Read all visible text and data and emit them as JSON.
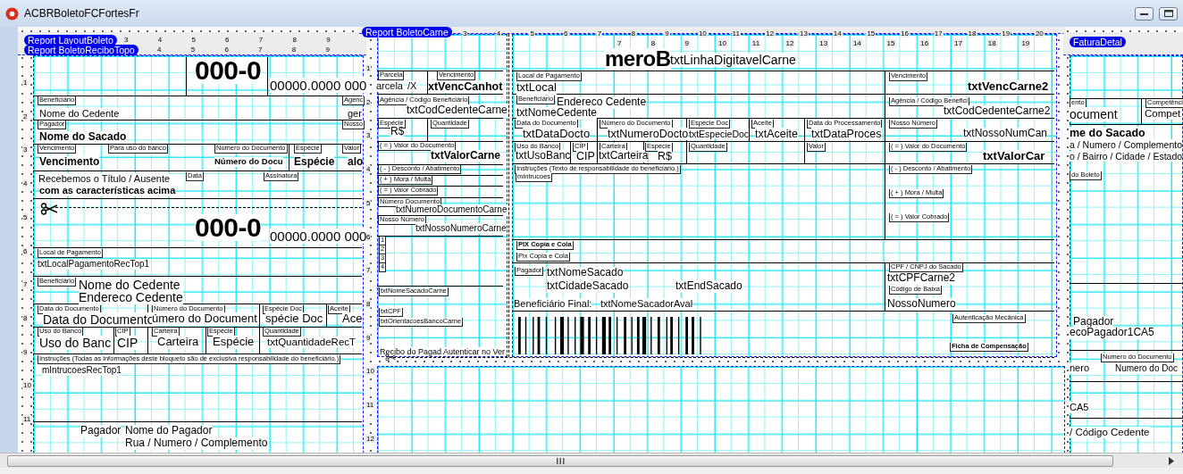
{
  "window": {
    "title": "ACBRBoletoFCFortesFr"
  },
  "bands": [
    "Report LayoutBoleto",
    "Report BoletoReciboTopo",
    "Report BoletoCarne",
    "FaturaDetal"
  ],
  "rulers": [
    {
      "labels": [
        "3",
        "4",
        "5",
        "6",
        "7",
        "8",
        "9"
      ]
    },
    {
      "labels": [
        "4",
        "5",
        "6",
        "7",
        "8",
        "9"
      ]
    },
    {
      "labels": [
        "1",
        "2",
        "3",
        "4",
        "5",
        "6",
        "7",
        "8",
        "9",
        "10",
        "11"
      ]
    },
    {
      "labels": [
        "3",
        "4",
        "5",
        "6",
        "7",
        "8",
        "9",
        "10",
        "11",
        "12",
        "13",
        "14",
        "15",
        "16",
        "17",
        "18",
        "19",
        "20"
      ]
    },
    {
      "labels": [
        "7",
        "8",
        "9",
        "10",
        "11",
        "12",
        "13",
        "14",
        "15",
        "16",
        "17",
        "18",
        "19"
      ]
    },
    {
      "labels": [
        "1",
        "2",
        "3",
        "4",
        "5",
        "6",
        "7",
        "8",
        "9",
        "10",
        "11",
        "12"
      ]
    }
  ],
  "fields": [
    {
      "kind": "big",
      "text": "000-0"
    },
    {
      "kind": "value",
      "text": "00000.0000 000"
    },
    {
      "kind": "caption",
      "text": "Beneficiário"
    },
    {
      "kind": "value",
      "text": "Nome do Cedente"
    },
    {
      "kind": "caption",
      "text": "Agenc"
    },
    {
      "kind": "value",
      "text": "ger"
    },
    {
      "kind": "caption",
      "text": "Pagador"
    },
    {
      "kind": "bold",
      "text": "Nome do Sacado"
    },
    {
      "kind": "caption",
      "text": "Nosso"
    },
    {
      "kind": "caption",
      "text": "Vencimento"
    },
    {
      "kind": "caption",
      "text": "Para uso do banco"
    },
    {
      "kind": "caption",
      "text": "Número do Documento"
    },
    {
      "kind": "caption",
      "text": "Espécie"
    },
    {
      "kind": "caption",
      "text": "Valor"
    },
    {
      "kind": "bold",
      "text": "Vencimento"
    },
    {
      "kind": "bold",
      "text": "Número do Docu"
    },
    {
      "kind": "bold",
      "text": "Espécie"
    },
    {
      "kind": "bold",
      "text": "alo"
    },
    {
      "kind": "value",
      "text": "Recebemos o Título / Ausente"
    },
    {
      "kind": "caption",
      "text": "Data"
    },
    {
      "kind": "caption",
      "text": "Assinatura"
    },
    {
      "kind": "bold",
      "text": "com as características acima"
    },
    {
      "kind": "big",
      "text": "000-0"
    },
    {
      "kind": "value",
      "text": "00000.0000 000"
    },
    {
      "kind": "caption",
      "text": "Local de Pagamento"
    },
    {
      "kind": "value",
      "text": "txtLocalPagamentoRecTop1"
    },
    {
      "kind": "caption",
      "text": "Beneficiário"
    },
    {
      "kind": "value",
      "text": "Nome do Cedente"
    },
    {
      "kind": "value",
      "text": "Endereco Cedente"
    },
    {
      "kind": "caption",
      "text": "Data do Documento"
    },
    {
      "kind": "value",
      "text": "Data do Documento"
    },
    {
      "kind": "caption",
      "text": "Número do Documento"
    },
    {
      "kind": "value",
      "text": "úmero do Document"
    },
    {
      "kind": "caption",
      "text": "Espécie Doc"
    },
    {
      "kind": "value",
      "text": "spécie Doc"
    },
    {
      "kind": "caption",
      "text": "Aceite"
    },
    {
      "kind": "value",
      "text": "Ace"
    },
    {
      "kind": "caption",
      "text": "Uso do Banco"
    },
    {
      "kind": "value",
      "text": "Uso do Banc"
    },
    {
      "kind": "caption",
      "text": "CIP"
    },
    {
      "kind": "value",
      "text": "CIP"
    },
    {
      "kind": "caption",
      "text": "Carteira"
    },
    {
      "kind": "value",
      "text": "Carteira"
    },
    {
      "kind": "caption",
      "text": "Espécie"
    },
    {
      "kind": "value",
      "text": "Espécie"
    },
    {
      "kind": "caption",
      "text": "Quantidade"
    },
    {
      "kind": "value",
      "text": "txtQuantidadeRecT"
    },
    {
      "kind": "caption",
      "text": "Instruções (Todas as informações deste bloqueto são de exclusiva responsabilidade do beneficiário.)"
    },
    {
      "kind": "value",
      "text": "mIntrucoesRecTop1"
    },
    {
      "kind": "value",
      "text": "Pagador"
    },
    {
      "kind": "value",
      "text": "Nome do Pagador"
    },
    {
      "kind": "value",
      "text": "Rua / Numero / Complemento"
    },
    {
      "kind": "caption",
      "text": "Parcela"
    },
    {
      "kind": "value",
      "text": "arcela"
    },
    {
      "kind": "value",
      "text": "/X"
    },
    {
      "kind": "caption",
      "text": "Vencimento"
    },
    {
      "kind": "bold",
      "text": "xtVencCanhot"
    },
    {
      "kind": "caption",
      "text": "Agência / Código Beneficiário"
    },
    {
      "kind": "value",
      "text": "txtCodCedenteCarne"
    },
    {
      "kind": "caption",
      "text": "Espécie"
    },
    {
      "kind": "value",
      "text": "R$"
    },
    {
      "kind": "caption",
      "text": "Quantidade"
    },
    {
      "kind": "caption",
      "text": "( = ) Valor do Documento"
    },
    {
      "kind": "bold",
      "text": "txtValorCarne"
    },
    {
      "kind": "caption",
      "text": "( - ) Desconto / Abatimento"
    },
    {
      "kind": "caption",
      "text": "( + ) Mora / Multa"
    },
    {
      "kind": "caption",
      "text": "( = ) Valor Cobrado"
    },
    {
      "kind": "caption",
      "text": "Número Documento"
    },
    {
      "kind": "value",
      "text": "txtNumeroDocumentoCarne"
    },
    {
      "kind": "caption",
      "text": "Nosso Número"
    },
    {
      "kind": "value",
      "text": "txtNossoNumeroCarne"
    },
    {
      "kind": "caption",
      "text": "1"
    },
    {
      "kind": "caption",
      "text": "2"
    },
    {
      "kind": "caption",
      "text": "3"
    },
    {
      "kind": "caption",
      "text": "4"
    },
    {
      "kind": "caption",
      "text": "txtNomeSacadoCarne"
    },
    {
      "kind": "caption",
      "text": "txtCPF"
    },
    {
      "kind": "caption",
      "text": "txtOrientacoesBancoCarne"
    },
    {
      "kind": "value",
      "text": "Recibo do Pagad"
    },
    {
      "kind": "value",
      "text": "Autenticar no Ver"
    },
    {
      "kind": "big",
      "text": "meroB"
    },
    {
      "kind": "value",
      "text": "txtLinhaDigitavelCarne"
    },
    {
      "kind": "caption",
      "text": "Local de Pagamento"
    },
    {
      "kind": "value",
      "text": "txtLocal"
    },
    {
      "kind": "caption",
      "text": "Vencimento"
    },
    {
      "kind": "bold",
      "text": "txtVencCarne2"
    },
    {
      "kind": "caption",
      "text": "Beneficiário"
    },
    {
      "kind": "value",
      "text": "Endereco Cedente"
    },
    {
      "kind": "value",
      "text": "txtNomeCedente"
    },
    {
      "kind": "caption",
      "text": "Agência / Código Benefici"
    },
    {
      "kind": "value",
      "text": "txtCodCedenteCarne2"
    },
    {
      "kind": "caption",
      "text": "Data do Documento"
    },
    {
      "kind": "value",
      "text": "txtDataDocto"
    },
    {
      "kind": "caption",
      "text": "Número do Documento"
    },
    {
      "kind": "value",
      "text": "txtNumeroDocto"
    },
    {
      "kind": "caption",
      "text": "Espécie Doc"
    },
    {
      "kind": "value",
      "text": "txtEspecieDoc"
    },
    {
      "kind": "caption",
      "text": "Aceite"
    },
    {
      "kind": "value",
      "text": "txtAceite"
    },
    {
      "kind": "caption",
      "text": "Data do Processamento"
    },
    {
      "kind": "value",
      "text": "txtDataProces"
    },
    {
      "kind": "caption",
      "text": "Nosso Número"
    },
    {
      "kind": "value",
      "text": "txtNossoNumCan"
    },
    {
      "kind": "caption",
      "text": "Uso do Banco"
    },
    {
      "kind": "value",
      "text": "txtUsoBanc"
    },
    {
      "kind": "caption",
      "text": "CIP"
    },
    {
      "kind": "value",
      "text": "CIP"
    },
    {
      "kind": "caption",
      "text": "Carteira"
    },
    {
      "kind": "value",
      "text": "txtCarteira"
    },
    {
      "kind": "caption",
      "text": "Espécie"
    },
    {
      "kind": "value",
      "text": "R$"
    },
    {
      "kind": "caption",
      "text": "Quantidade"
    },
    {
      "kind": "caption",
      "text": "Valor"
    },
    {
      "kind": "caption",
      "text": "( = ) Valor do Documento"
    },
    {
      "kind": "bold",
      "text": "txtValorCar"
    },
    {
      "kind": "caption",
      "text": "Instruções (Texto de responsabilidade do beneficiário.)"
    },
    {
      "kind": "caption",
      "text": "mIntrucoes"
    },
    {
      "kind": "caption",
      "text": "( - ) Desconto / Abatimento"
    },
    {
      "kind": "caption",
      "text": "( + ) Mora / Multa"
    },
    {
      "kind": "caption",
      "text": "( = ) Valor Cobrado"
    },
    {
      "kind": "caption-bold",
      "text": "PIX Copia e Cola"
    },
    {
      "kind": "caption",
      "text": "Pix Copia e Cola"
    },
    {
      "kind": "caption",
      "text": "Pagador"
    },
    {
      "kind": "value",
      "text": "txtNomeSacado"
    },
    {
      "kind": "value",
      "text": "txtCidadeSacado"
    },
    {
      "kind": "value",
      "text": "txtEndSacado"
    },
    {
      "kind": "caption",
      "text": "CPF / CNPJ do Sacado"
    },
    {
      "kind": "value",
      "text": "txtCPFCarne2"
    },
    {
      "kind": "caption",
      "text": "Código de Baixa"
    },
    {
      "kind": "value",
      "text": "Beneficiário Final:"
    },
    {
      "kind": "value",
      "text": "txtNomeSacadorAval"
    },
    {
      "kind": "value",
      "text": "NossoNumero"
    },
    {
      "kind": "caption",
      "text": "Autenticação Mecânica"
    },
    {
      "kind": "caption-bold",
      "text": "Ficha de Compensação"
    },
    {
      "kind": "caption",
      "text": "ento"
    },
    {
      "kind": "value",
      "text": "ocument"
    },
    {
      "kind": "caption",
      "text": "Competênci"
    },
    {
      "kind": "value",
      "text": "Compet"
    },
    {
      "kind": "bold",
      "text": "me do Sacado"
    },
    {
      "kind": "value",
      "text": "a / Numero / Complemento"
    },
    {
      "kind": "value",
      "text": "o / Bairro / Cidade / Estado"
    },
    {
      "kind": "caption",
      "text": "do Boleto"
    },
    {
      "kind": "value",
      "text": "Pagador"
    },
    {
      "kind": "value",
      "text": "ecoPagador1CA5"
    },
    {
      "kind": "caption",
      "text": "Numero do Documento"
    },
    {
      "kind": "value",
      "text": "nero"
    },
    {
      "kind": "value",
      "text": "Numero do Doc"
    },
    {
      "kind": "value",
      "text": "CA5"
    },
    {
      "kind": "value",
      "text": "/ Código Cedente"
    }
  ]
}
